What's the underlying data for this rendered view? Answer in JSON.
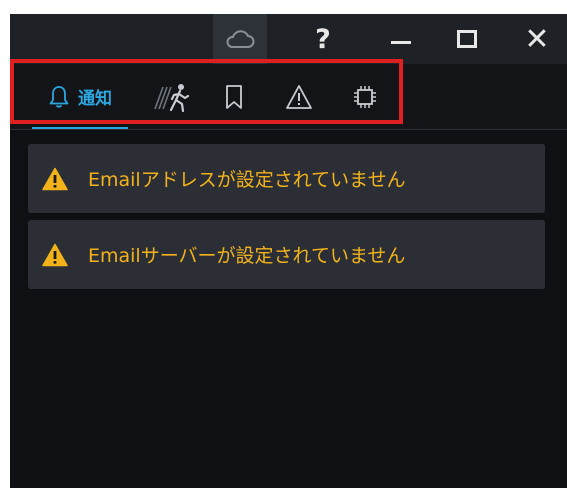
{
  "titlebar": {
    "cloud_icon": "cloud-icon",
    "help_label": "?",
    "minimize_icon": "minimize-icon",
    "maximize_icon": "maximize-icon",
    "close_label": "✕"
  },
  "tabs": [
    {
      "name": "tab-notifications",
      "icon": "bell-icon",
      "label": "通知",
      "active": true
    },
    {
      "name": "tab-motion",
      "icon": "motion-icon",
      "active": false
    },
    {
      "name": "tab-bookmarks",
      "icon": "bookmark-icon",
      "active": false
    },
    {
      "name": "tab-warnings",
      "icon": "warning-icon",
      "active": false
    },
    {
      "name": "tab-system",
      "icon": "chip-icon",
      "active": false
    }
  ],
  "notifications": [
    {
      "icon": "warning-icon",
      "text": "Emailアドレスが設定されていません"
    },
    {
      "icon": "warning-icon",
      "text": "Emailサーバーが設定されていません"
    }
  ],
  "colors": {
    "accent": "#2aa7e0",
    "warning": "#f2b21a",
    "highlight": "#e02020",
    "background": "#0f1014",
    "panel": "#2b2f35"
  }
}
